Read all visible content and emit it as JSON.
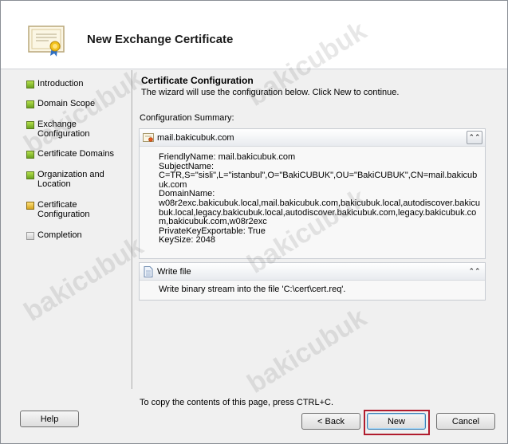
{
  "window": {
    "title": "New Exchange Certificate"
  },
  "nav": {
    "items": [
      {
        "label": "Introduction",
        "state": "done"
      },
      {
        "label": "Domain Scope",
        "state": "done"
      },
      {
        "label": "Exchange Configuration",
        "state": "done"
      },
      {
        "label": "Certificate Domains",
        "state": "done"
      },
      {
        "label": "Organization and Location",
        "state": "done"
      },
      {
        "label": "Certificate Configuration",
        "state": "active"
      },
      {
        "label": "Completion",
        "state": "pending"
      }
    ]
  },
  "main": {
    "section_title": "Certificate Configuration",
    "section_desc": "The wizard will use the configuration below.  Click New to continue.",
    "summary_label": "Configuration Summary:",
    "panels": [
      {
        "title": "mail.bakicubuk.com",
        "icon": "certificate-icon",
        "lines": [
          "FriendlyName: mail.bakicubuk.com",
          "SubjectName:",
          "C=TR,S=\"sisli\",L=\"istanbul\",O=\"BakiCUBUK\",OU=\"BakiCUBUK\",CN=mail.bakicubuk.com",
          "DomainName:",
          "w08r2exc.bakicubuk.local,mail.bakicubuk.com,bakicubuk.local,autodiscover.bakicubuk.local,legacy.bakicubuk.local,autodiscover.bakicubuk.com,legacy.bakicubuk.com,bakicubuk.com,w08r2exc",
          "PrivateKeyExportable: True",
          "KeySize: 2048"
        ]
      },
      {
        "title": "Write file",
        "icon": "document-icon",
        "lines": [
          "Write binary stream into the file 'C:\\cert\\cert.req'."
        ]
      }
    ],
    "collapse_glyph": "⌃"
  },
  "footer": {
    "copy_hint": "To copy the contents of this page, press CTRL+C.",
    "help_label": "Help",
    "back_label": "< Back",
    "new_label": "New",
    "cancel_label": "Cancel"
  },
  "watermark": "bakicubuk",
  "colors": {
    "highlight": "#b01c2e",
    "done": "#6aa321",
    "active": "#d4a420"
  }
}
